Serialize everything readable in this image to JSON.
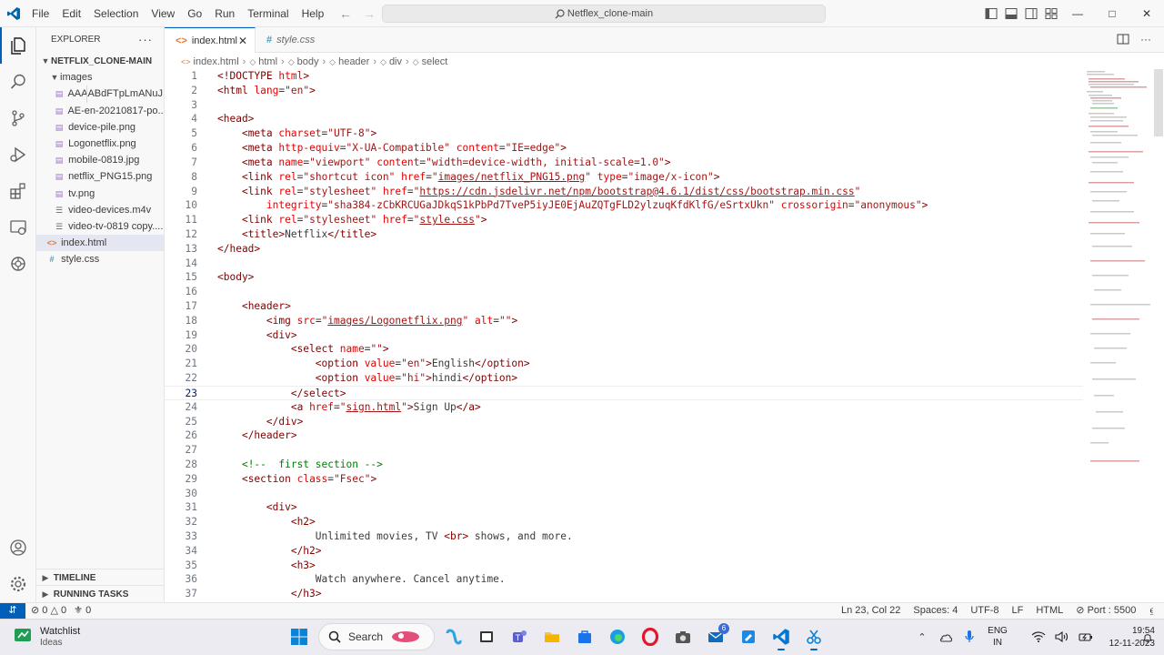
{
  "titlebar": {
    "menus": [
      "File",
      "Edit",
      "Selection",
      "View",
      "Go",
      "Run",
      "Terminal",
      "Help"
    ],
    "command_center": "Netflex_clone-main",
    "window_controls": [
      "minimize",
      "maximize",
      "close"
    ]
  },
  "activity_bar": {
    "items": [
      "explorer-icon",
      "search-icon",
      "source-control-icon",
      "run-debug-icon",
      "extensions-icon",
      "remote-explorer-icon",
      "chatgpt-icon"
    ],
    "bottom": [
      "account-icon",
      "settings-gear-icon"
    ]
  },
  "explorer": {
    "title": "EXPLORER",
    "more": "···",
    "root": "NETFLIX_CLONE-MAIN",
    "folder": "images",
    "files": [
      "AAAABdFTpLmANuJ...",
      "AE-en-20210817-po...",
      "device-pile.png",
      "Logonetflix.png",
      "mobile-0819.jpg",
      "netflix_PNG15.png",
      "tv.png",
      "video-devices.m4v",
      "video-tv-0819 copy...."
    ],
    "root_files": [
      "index.html",
      "style.css"
    ],
    "timeline": "TIMELINE",
    "running_tasks": "RUNNING TASKS"
  },
  "tabs": [
    {
      "label": "index.html",
      "icon": "<>",
      "active": true
    },
    {
      "label": "style.css",
      "icon": "#",
      "active": false
    }
  ],
  "breadcrumb": [
    "index.html",
    "html",
    "body",
    "header",
    "div",
    "select"
  ],
  "code": {
    "current_line": 23,
    "line_numbers": [
      "1",
      "2",
      "3",
      "4",
      "5",
      "6",
      "7",
      "8",
      "9",
      "10",
      "11",
      "12",
      "13",
      "14",
      "15",
      "16",
      "17",
      "18",
      "19",
      "20",
      "21",
      "22",
      "23",
      "24",
      "25",
      "26",
      "27",
      "28",
      "29",
      "30",
      "31",
      "32",
      "33",
      "34",
      "35",
      "36",
      "37"
    ]
  },
  "status_bar": {
    "errors": "0",
    "warnings": "0",
    "ports_left": "0",
    "position": "Ln 23, Col 22",
    "spaces": "Spaces: 4",
    "encoding": "UTF-8",
    "eol": "LF",
    "language": "HTML",
    "port": "Port : 5500"
  },
  "taskbar": {
    "weather_title": "Watchlist",
    "weather_sub": "Ideas",
    "search_placeholder": "Search",
    "lang_top": "ENG",
    "lang_bottom": "IN",
    "time": "19:54",
    "date": "12-11-2023",
    "badge": "6"
  },
  "colors": {
    "accent": "#005fb8",
    "tag": "#800000",
    "attr": "#e50000",
    "string": "#a31515",
    "comment": "#008000"
  }
}
